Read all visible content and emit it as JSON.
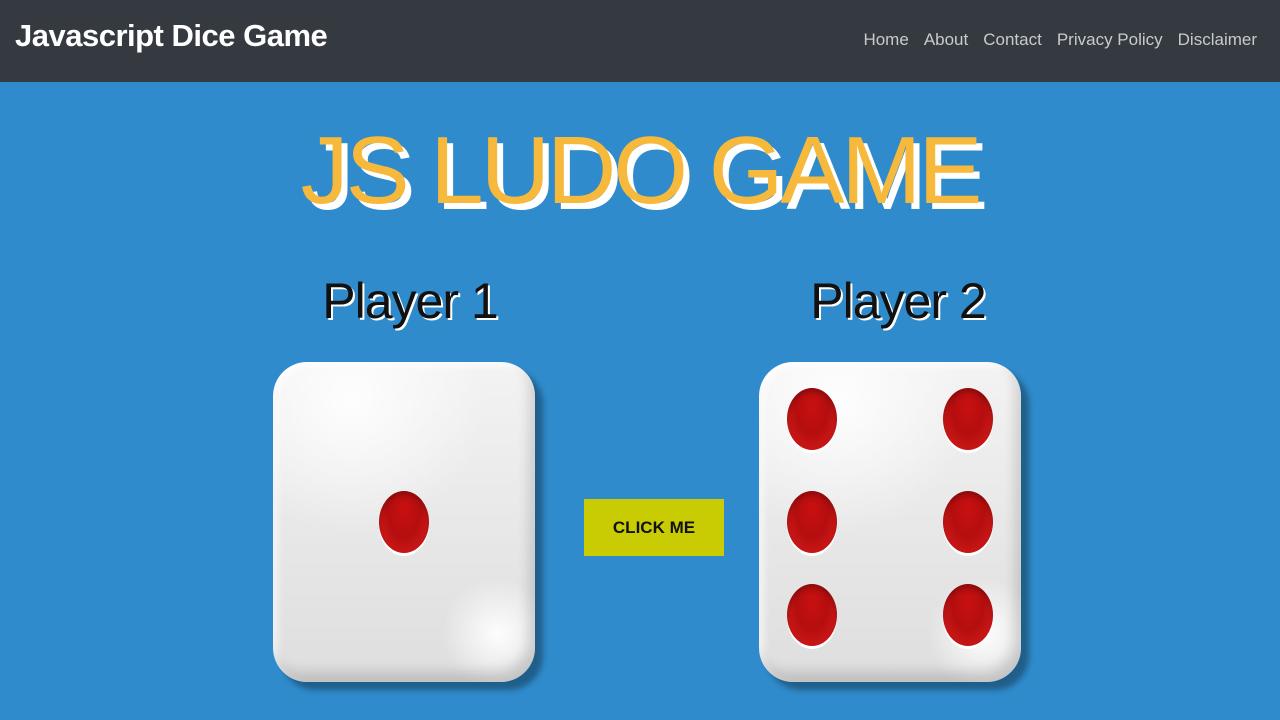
{
  "navbar": {
    "brand": "Javascript Dice Game",
    "links": [
      {
        "label": "Home"
      },
      {
        "label": "About"
      },
      {
        "label": "Contact"
      },
      {
        "label": "Privacy Policy"
      },
      {
        "label": "Disclaimer"
      }
    ]
  },
  "game": {
    "title": "JS LUDO GAME",
    "players": [
      {
        "label": "Player 1",
        "die_value": 1
      },
      {
        "label": "Player 2",
        "die_value": 6
      }
    ],
    "roll_button": "CLICK ME"
  },
  "colors": {
    "navbar_bg": "#343a40",
    "page_bg": "#2f8bcb",
    "title": "#f6b93b",
    "button_bg": "#c9cc02",
    "pip": "#c81010"
  }
}
